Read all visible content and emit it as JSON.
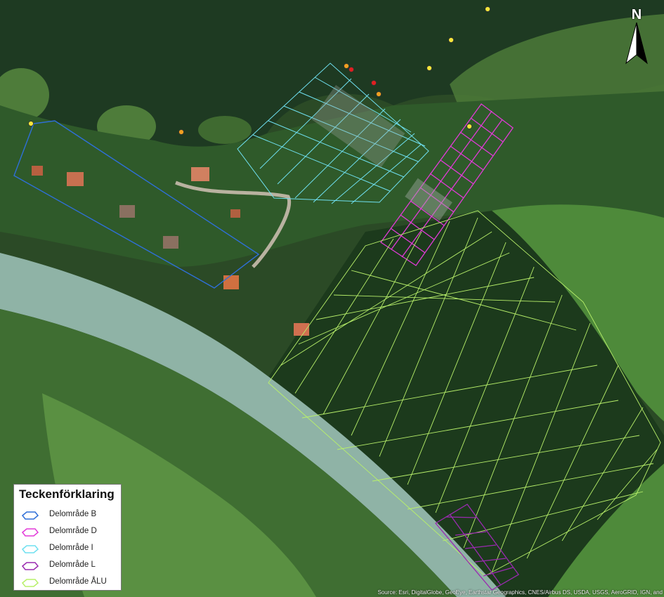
{
  "legend": {
    "title": "Teckenförklaring",
    "items": [
      {
        "label": "Delområde B",
        "color": "#2f6fd8"
      },
      {
        "label": "Delområde D",
        "color": "#e23ad8"
      },
      {
        "label": "Delområde I",
        "color": "#6fe0f0"
      },
      {
        "label": "Delområde L",
        "color": "#9a2ab0"
      },
      {
        "label": "Delområde ÅLU",
        "color": "#b8f06a"
      }
    ]
  },
  "north_arrow": {
    "label": "N"
  },
  "attribution": "Source: Esri, DigitalGlobe, GeoEye, Earthstar Geographics, CNES/Airbus DS, USDA, USGS, AeroGRID, IGN, and",
  "colors": {
    "lake": "#1e3a22",
    "reeds": "#4c7a38",
    "forest": "#1c3a1c",
    "field": "#4e8a3a",
    "river": "#8fb3a6"
  },
  "point_colors": {
    "yellow": "#f5e63a",
    "orange": "#f0a020",
    "red": "#e02020"
  }
}
